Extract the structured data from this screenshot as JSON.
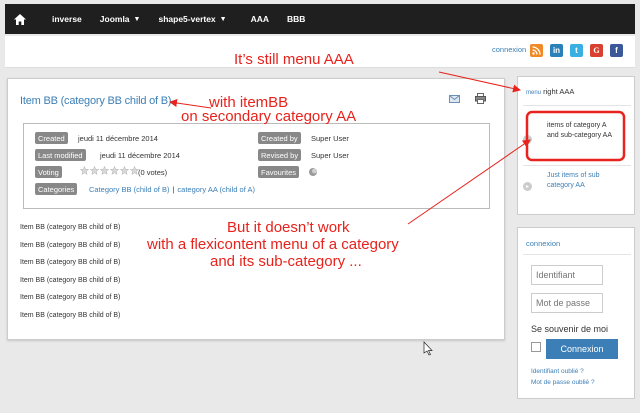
{
  "nav": {
    "items": [
      {
        "label": "inverse",
        "dropdown": false
      },
      {
        "label": "Joomla",
        "dropdown": true
      },
      {
        "label": "shape5-vertex",
        "dropdown": true
      },
      {
        "label": "AAA",
        "dropdown": false
      },
      {
        "label": "BBB",
        "dropdown": false
      }
    ]
  },
  "toolbar": {
    "connexion_label": "connexion",
    "social_icons": [
      "rss-icon",
      "linkedin-icon",
      "twitter-icon",
      "googleplus-icon",
      "facebook-icon"
    ]
  },
  "article": {
    "title": "Item BB (category BB child of B)",
    "info": {
      "created_label": "Created",
      "created_value": "jeudi 11 décembre 2014",
      "created_by_label": "Created by",
      "created_by_value": "Super User",
      "modified_label": "Last modified",
      "modified_value": "jeudi 11 décembre 2014",
      "revised_by_label": "Revised by",
      "revised_by_value": "Super User",
      "voting_label": "Voting",
      "votes": "(0 votes)",
      "favourites_label": "Favourites",
      "categories_label": "Categories",
      "category_1": "Category BB (child of B)",
      "separator": "|",
      "category_2": "category AA (child of A)"
    },
    "list_items": [
      "Item BB (category BB child of B)",
      "Item BB (category BB child of B)",
      "Item BB (category BB child of B)",
      "Item BB (category BB child of B)",
      "Item BB (category BB child of B)",
      "Item BB (category BB child of B)"
    ]
  },
  "side_menu": {
    "title_prefix": "menu",
    "title": "right AAA",
    "item_1": "items of category A and sub-category AA",
    "item_2": "Just items of sub category AA"
  },
  "login": {
    "title": "connexion",
    "username_placeholder": "Identifiant",
    "password_placeholder": "Mot de passe",
    "remember_label": "Se souvenir de moi",
    "submit_label": "Connexion",
    "forgot_username": "Identifiant oublié ?",
    "forgot_password": "Mot de passe oublié ?"
  },
  "annotations": {
    "menu_note": "It’s still menu AAA",
    "item_note_1": "with itemBB",
    "item_note_2": "on secondary category AA",
    "problem_1": "But it doesn’t work",
    "problem_2": "with a flexicontent menu of a category",
    "problem_3": "and its sub-category ..."
  },
  "colors": {
    "annotation": "#e8221c",
    "link": "#3c7fb6",
    "nav_bg": "#1f1f1f",
    "label_bg": "#888888"
  }
}
